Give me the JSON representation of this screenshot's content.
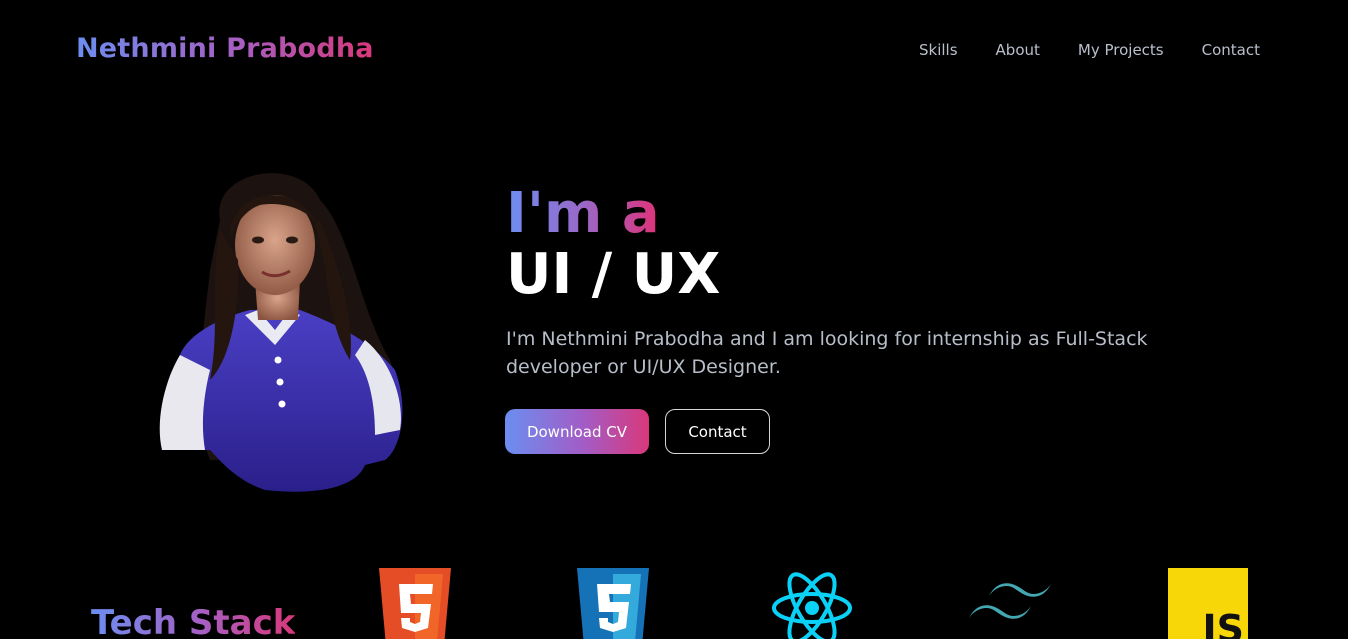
{
  "header": {
    "brand": "Nethmini Prabodha",
    "nav": [
      "Skills",
      "About",
      "My Projects",
      "Contact"
    ]
  },
  "hero": {
    "line1": "I'm a",
    "line2": "UI / UX",
    "description": "I'm Nethmini Prabodha and I am looking for internship as Full-Stack developer or UI/UX Designer.",
    "download_label": "Download CV",
    "contact_label": "Contact"
  },
  "tech_stack": {
    "title": "Tech Stack",
    "icons": [
      "html5-icon",
      "css3-icon",
      "react-icon",
      "tailwind-icon",
      "javascript-icon"
    ],
    "js_label": "JS"
  },
  "colors": {
    "background": "#000000",
    "gradient_start": "#6b8ef0",
    "gradient_mid": "#a85ec2",
    "gradient_end": "#d9387a",
    "nav_text": "#b9bfcb"
  }
}
